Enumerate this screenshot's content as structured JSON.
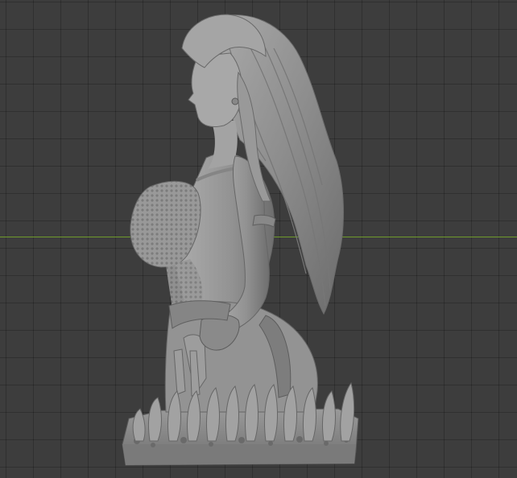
{
  "viewport": {
    "background_color": "#3d3d3d",
    "grid_line_color": "#2e2e2e",
    "x_axis_color": "#6f9a2c"
  },
  "model": {
    "description_icon": "sculpt-bust-model",
    "base_color": "#8f8f8f",
    "shadow_color": "#5e5e5e",
    "highlight_color": "#b4b4b4"
  }
}
